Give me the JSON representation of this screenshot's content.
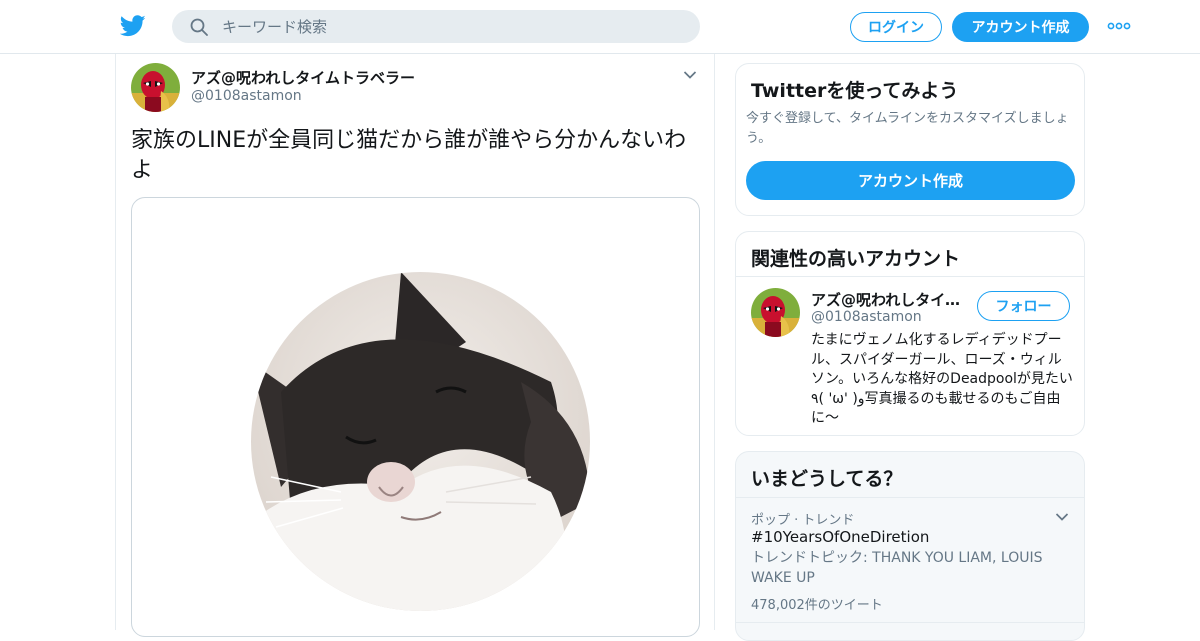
{
  "header": {
    "logo_icon": "twitter-bird-icon",
    "search": {
      "placeholder": "キーワード検索",
      "value": ""
    },
    "login_label": "ログイン",
    "signup_label": "アカウント作成",
    "more_icon": "more-dots-icon"
  },
  "tweet": {
    "author_name": "アズ@呪われしタイムトラベラー",
    "author_handle": "@0108astamon",
    "text": "家族のLINEが全員同じ猫だから誰が誰やら分かんないわよ",
    "menu_icon": "chevron-down-icon",
    "media_icon": "cat-photo"
  },
  "sidebar": {
    "signup_card": {
      "title": "Twitterを使ってみよう",
      "description": "今すぐ登録して、タイムラインをカスタマイズしましょう。",
      "button_label": "アカウント作成"
    },
    "related_card": {
      "title": "関連性の高いアカウント",
      "account": {
        "name": "アズ@呪われしタイムトラベラー",
        "handle": "@0108astamon",
        "follow_label": "フォロー",
        "bio": "たまにヴェノム化するレディデッドプール、スパイダーガール、ローズ・ウィルソン。いろんな格好のDeadpoolが見たい٩( 'ω' )و写真撮るのも載せるのもご自由に〜"
      }
    },
    "trends_card": {
      "title": "いまどうしてる？",
      "trend": {
        "context": "ポップ · トレンド",
        "name": "#10YearsOfOneDiretion",
        "description": "トレンドトピック: THANK YOU LIAM, LOUIS WAKE UP",
        "count": "478,002件のツイート"
      }
    }
  },
  "colors": {
    "accent": "#1da1f2",
    "secondary_text": "#657786",
    "border": "#e6ecf0",
    "search_bg": "#e6ecf0"
  }
}
